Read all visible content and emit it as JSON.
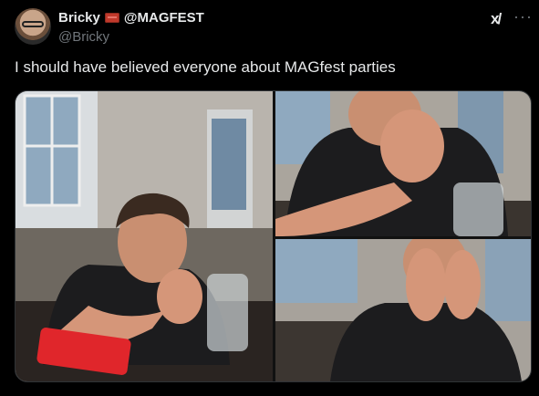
{
  "author": {
    "display_name": "Bricky",
    "emoji_icon": "brick-icon",
    "handle": "@Bricky",
    "username_mention": "@MAGFEST"
  },
  "header_icons": {
    "grok": "x/ grok-icon",
    "grok_glyph": "x/",
    "more": "more-icon",
    "more_glyph": "···"
  },
  "post": {
    "text": "I should have believed everyone about MAGfest parties"
  },
  "media": {
    "count": 3,
    "images": [
      "photo-man-praying-hands-restaurant",
      "photo-man-praying-closeup",
      "photo-man-hands-on-face"
    ]
  },
  "colors": {
    "background": "#000000",
    "text_primary": "#e7e9ea",
    "text_secondary": "#71767b",
    "phone_red": "#e0262b"
  }
}
